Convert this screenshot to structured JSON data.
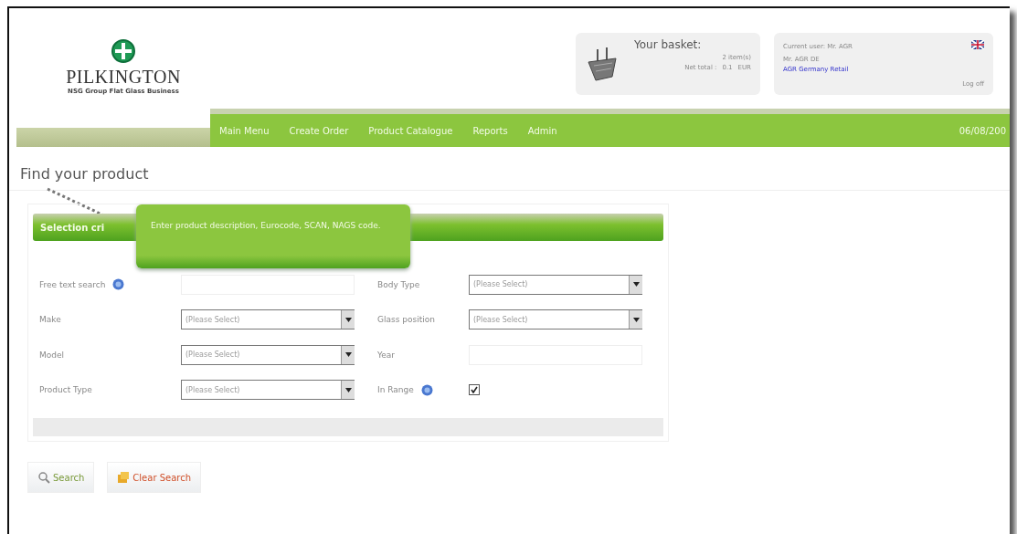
{
  "logo": {
    "name": "PILKINGTON",
    "tagline": "NSG Group Flat Glass Business"
  },
  "basket": {
    "title": "Your basket:",
    "items": "2 item(s)",
    "net_total_label": "Net total :",
    "net_total": "0.1",
    "currency": "EUR"
  },
  "user": {
    "current_user": "Current user: Mr. AGR",
    "name": "Mr. AGR DE",
    "company": "AGR Germany Retail",
    "log_off": "Log off"
  },
  "nav": {
    "items": [
      {
        "label": "Main Menu"
      },
      {
        "label": "Create Order"
      },
      {
        "label": "Product Catalogue"
      },
      {
        "label": "Reports"
      },
      {
        "label": "Admin"
      }
    ],
    "date": "06/08/200"
  },
  "page_title": "Find your product",
  "panel": {
    "header": "Selection cri",
    "tooltip": "Enter product description, Eurocode, SCAN, NAGS code.",
    "fields": [
      {
        "label": "Free text search",
        "kind": "text",
        "help": true
      },
      {
        "label": "Body Type",
        "kind": "select",
        "help": false,
        "value": "(Please Select)"
      },
      {
        "label": "Make",
        "kind": "select",
        "help": false,
        "value": "(Please Select)"
      },
      {
        "label": "Glass position",
        "kind": "select",
        "help": false,
        "value": "(Please Select)"
      },
      {
        "label": "Model",
        "kind": "select",
        "help": false,
        "value": "(Please Select)"
      },
      {
        "label": "Year",
        "kind": "text",
        "help": false
      },
      {
        "label": "Product Type",
        "kind": "select",
        "help": false,
        "value": "(Please Select)"
      },
      {
        "label": "In Range",
        "kind": "checkbox",
        "help": true,
        "checked": true
      }
    ]
  },
  "buttons": [
    {
      "label": "Search",
      "kind": "search"
    },
    {
      "label": "Clear Search",
      "kind": "clear"
    }
  ]
}
